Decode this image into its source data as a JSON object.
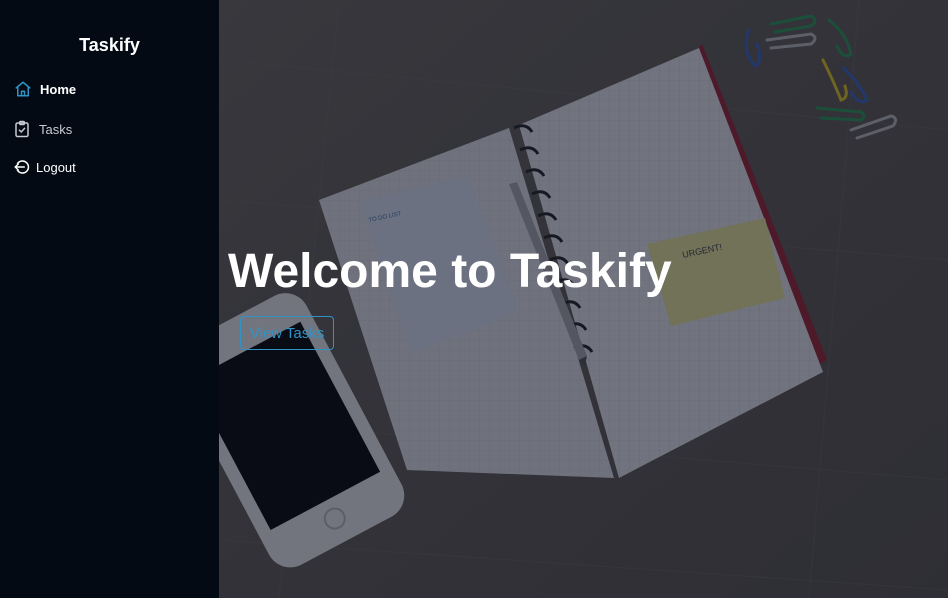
{
  "app": {
    "name": "Taskify"
  },
  "sidebar": {
    "items": [
      {
        "label": "Home",
        "icon": "home-icon",
        "active": true
      },
      {
        "label": "Tasks",
        "icon": "clipboard-check-icon",
        "active": false
      },
      {
        "label": "Logout",
        "icon": "logout-icon",
        "active": false
      }
    ]
  },
  "hero": {
    "title": "Welcome to Taskify",
    "button_label": "View Tasks",
    "background": "photo of open grid notebook with to-do list, sticky note, pen, smartphone and paper clips on a wooden desk"
  },
  "colors": {
    "sidebar_bg": "#040a14",
    "accent": "#2f93c6",
    "text_primary": "#ffffff",
    "text_muted": "#c8cbd0"
  }
}
